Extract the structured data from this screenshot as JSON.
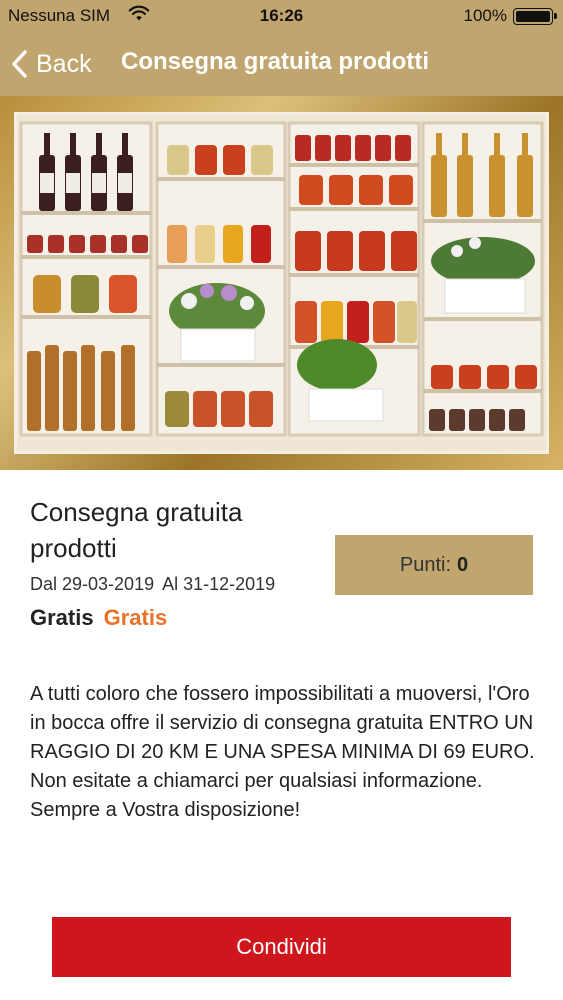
{
  "status_bar": {
    "carrier": "Nessuna SIM",
    "time": "16:26",
    "battery": "100%",
    "wifi_icon": "wifi-icon",
    "battery_icon": "battery-full-icon"
  },
  "nav": {
    "back_label": "Back",
    "back_icon": "chevron-left-icon",
    "title": "Consegna gratuita prodotti"
  },
  "hero": {
    "image": "shelf-photo"
  },
  "offer": {
    "title": "Consegna gratuita prodotti",
    "date_from": "Dal 29-03-2019",
    "date_to": "Al 31-12-2019",
    "price_original": "Gratis",
    "price_current": "Gratis",
    "points_label": "Punti:",
    "points_value": "0"
  },
  "description": "A tutti coloro che fossero impossibilitati a muoversi, l'Oro in bocca offre il servizio di consegna gratuita ENTRO UN RAGGIO DI 20 KM E UNA SPESA MINIMA DI 69 EURO. Non esitate a chiamarci per qualsiasi informazione. Sempre a Vostra disposizione!",
  "actions": {
    "share_label": "Condividi"
  },
  "colors": {
    "header": "#c1a56e",
    "accent_price": "#e8722a",
    "share_button": "#d0161d"
  }
}
